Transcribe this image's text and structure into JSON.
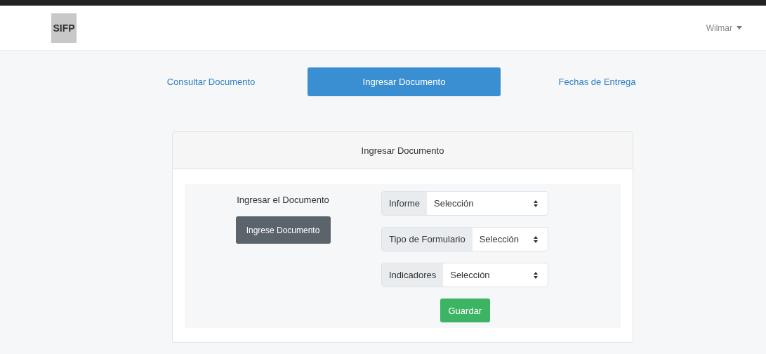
{
  "navbar": {
    "brand": "SIFP",
    "user": "Wilmar"
  },
  "tabs": [
    {
      "label": "Consultar Documento",
      "selected": false
    },
    {
      "label": "Ingresar Documento",
      "selected": true
    },
    {
      "label": "Fechas de Entrega",
      "selected": false
    }
  ],
  "card": {
    "title": "Ingresar Documento",
    "prompt": "Ingresar el Documento",
    "upload_button": "Ingrese Documento",
    "fields": [
      {
        "label": "Informe",
        "value": "Selección"
      },
      {
        "label": "Tipo de Formulario",
        "value": "Selección"
      },
      {
        "label": "Indicadores",
        "value": "Selección"
      }
    ],
    "save_button": "Guardar"
  }
}
